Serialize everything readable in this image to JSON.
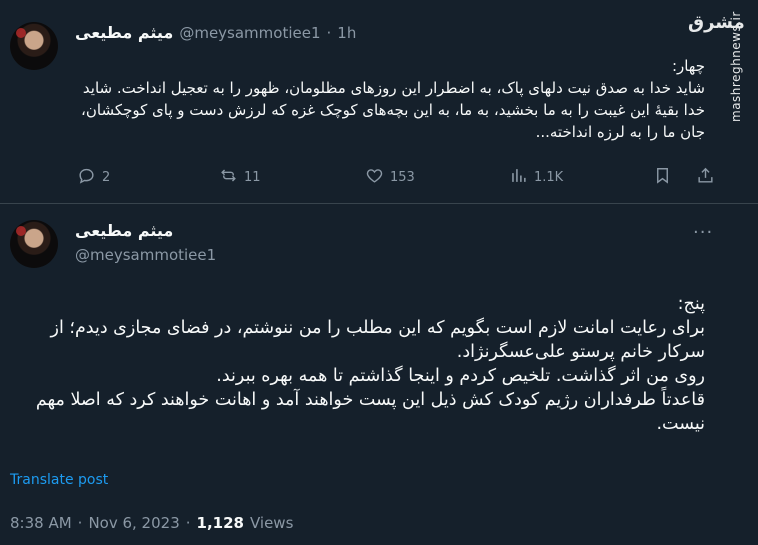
{
  "tweet1": {
    "author_name": "میثم مطیعی",
    "handle": "@meysammotiee1",
    "separator": "·",
    "time": "1h",
    "text": "چهار:\nشاید خدا به صدق نیت دلهای پاک، به اضطرار این روزهای مظلومان، ظهور را به تعجیل انداخت. شاید خدا بقیهٔ این غیبت را به ما بخشید، به ما، به این بچه‌های کوچک غزه که لرزش دست و پای کوچکشان، جان ما را به لرزه انداخته...",
    "actions": {
      "reply_count": "2",
      "repost_count": "11",
      "like_count": "153",
      "views_count": "1.1K"
    }
  },
  "tweet2": {
    "author_name": "میثم مطیعی",
    "handle": "@meysammotiee1",
    "more": "···",
    "text": "پنج:\nبرای رعایت امانت لازم است بگویم که این مطلب را من ننوشتم، در فضای مجازی دیدم؛ از سرکار خانم پرستو علی‌عسگرنژاد.\nروی من اثر گذاشت. تلخیص کردم و اینجا گذاشتم تا همه بهره ببرند.\nقاعدتاً طرفداران رژیم کودک کش ذیل این پست خواهند آمد و اهانت خواهند کرد که اصلا مهم نیست.",
    "translate_label": "Translate post",
    "meta": {
      "time": "8:38 AM",
      "dot1": "·",
      "date": "Nov 6, 2023",
      "dot2": "·",
      "views_value": "1,128",
      "views_label": "Views"
    }
  },
  "watermark": {
    "logo": "مشرق",
    "site": "mashreghnews.ir"
  },
  "colors": {
    "background": "#15202b",
    "text": "#f7f9f9",
    "muted": "#8b98a5",
    "link": "#1d9bf0",
    "divider": "#38444d"
  }
}
